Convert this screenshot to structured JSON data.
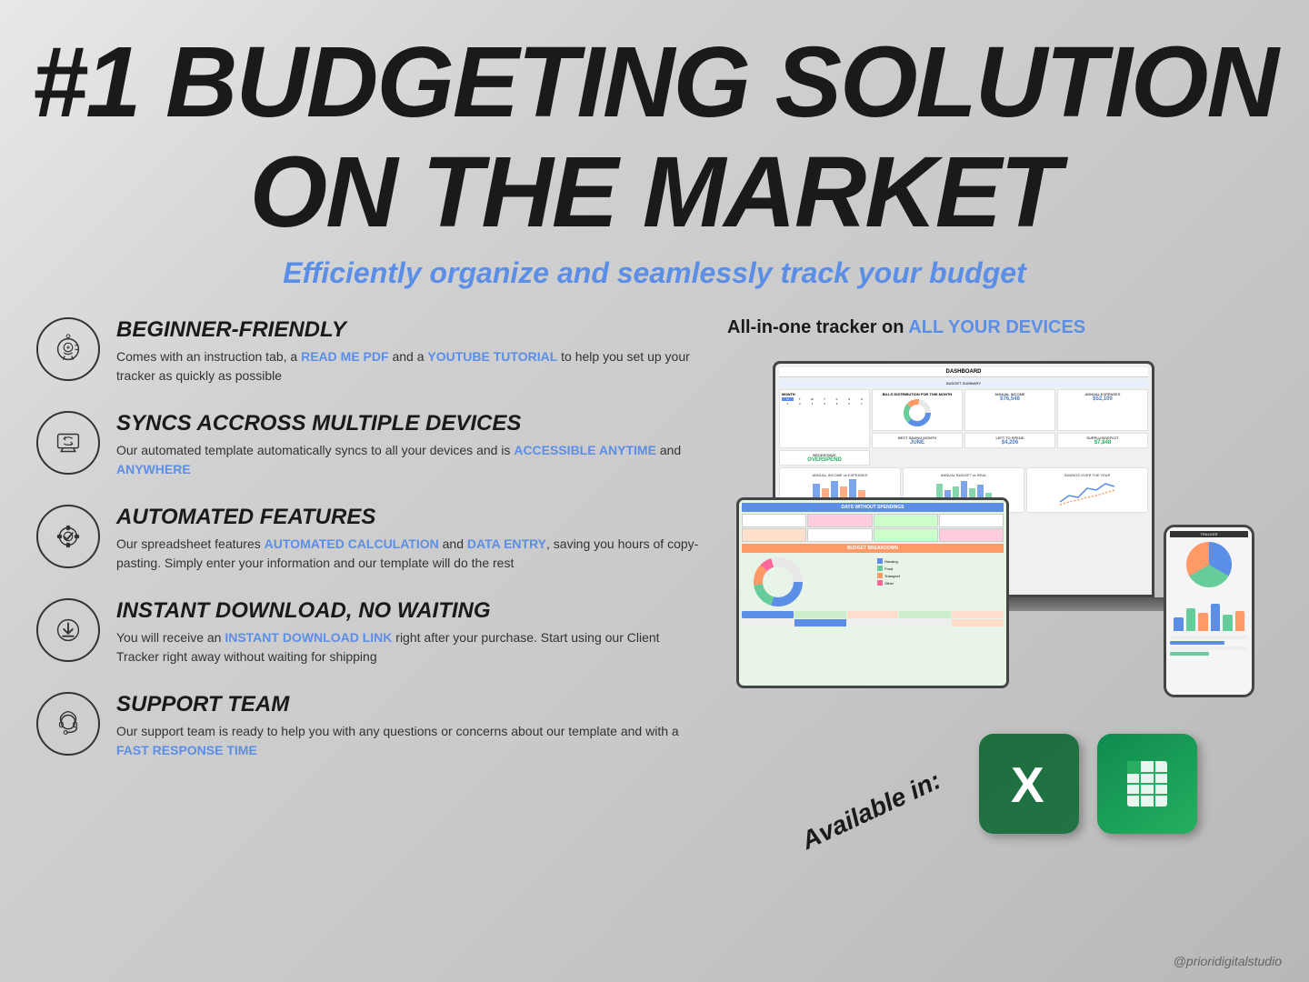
{
  "title": {
    "line1": "#1 BUDGETING SOLUTION",
    "line2": "ON THE MARKET"
  },
  "subtitle": "Efficiently organize and seamlessly track your budget",
  "features": [
    {
      "id": "beginner-friendly",
      "icon": "piggy-bank-icon",
      "heading": "BEGINNER-FRIENDLY",
      "text_parts": [
        {
          "text": "Comes with an instruction tab, a ",
          "highlight": false
        },
        {
          "text": "READ ME PDF",
          "highlight": true
        },
        {
          "text": " and a ",
          "highlight": false
        },
        {
          "text": "YOUTUBE TUTORIAL",
          "highlight": true
        },
        {
          "text": " to help you set up your tracker as quickly as possible",
          "highlight": false
        }
      ]
    },
    {
      "id": "syncs-devices",
      "icon": "sync-devices-icon",
      "heading": "SYNCS ACCROSS MULTIPLE DEVICES",
      "text_parts": [
        {
          "text": "Our automated template automatically syncs to all your devices and is ",
          "highlight": false
        },
        {
          "text": "ACCESSIBLE ANYTIME",
          "highlight": true
        },
        {
          "text": " and ",
          "highlight": false
        },
        {
          "text": "ANYWHERE",
          "highlight": true
        }
      ]
    },
    {
      "id": "automated-features",
      "icon": "checkmark-gear-icon",
      "heading": "AUTOMATED FEATURES",
      "text_parts": [
        {
          "text": "Our spreadsheet features ",
          "highlight": false
        },
        {
          "text": "AUTOMATED CALCULATION",
          "highlight": true
        },
        {
          "text": " and ",
          "highlight": false
        },
        {
          "text": "DATA ENTRY",
          "highlight": true
        },
        {
          "text": ", saving you hours of copy-pasting. Simply enter your information and our template will do the rest",
          "highlight": false
        }
      ]
    },
    {
      "id": "instant-download",
      "icon": "download-icon",
      "heading": "INSTANT DOWNLOAD, NO WAITING",
      "text_parts": [
        {
          "text": "You will receive an ",
          "highlight": false
        },
        {
          "text": "INSTANT DOWNLOAD LINK",
          "highlight": true
        },
        {
          "text": " right after your purchase. Start using our Client Tracker right away without waiting for shipping",
          "highlight": false
        }
      ]
    },
    {
      "id": "support-team",
      "icon": "support-icon",
      "heading": "SUPPORT TEAM",
      "text_parts": [
        {
          "text": "Our support team is ready to help you with any questions or concerns about our template and with a ",
          "highlight": false
        },
        {
          "text": "FAST RESPONSE TIME",
          "highlight": true
        }
      ]
    }
  ],
  "right_panel": {
    "heading_normal": "All-in-one tracker on ",
    "heading_highlight": "ALL YOUR DEVICES",
    "dashboard_title": "DASHBOARD",
    "available_text": "Available in:",
    "apps": [
      {
        "name": "Excel",
        "letter": "X"
      },
      {
        "name": "Google Sheets",
        "letter": "⊞"
      }
    ]
  },
  "watermark": "@prioridigitalstudio",
  "colors": {
    "highlight": "#5b8ee6",
    "dark": "#1a1a1a",
    "background": "#d4d4d4"
  }
}
